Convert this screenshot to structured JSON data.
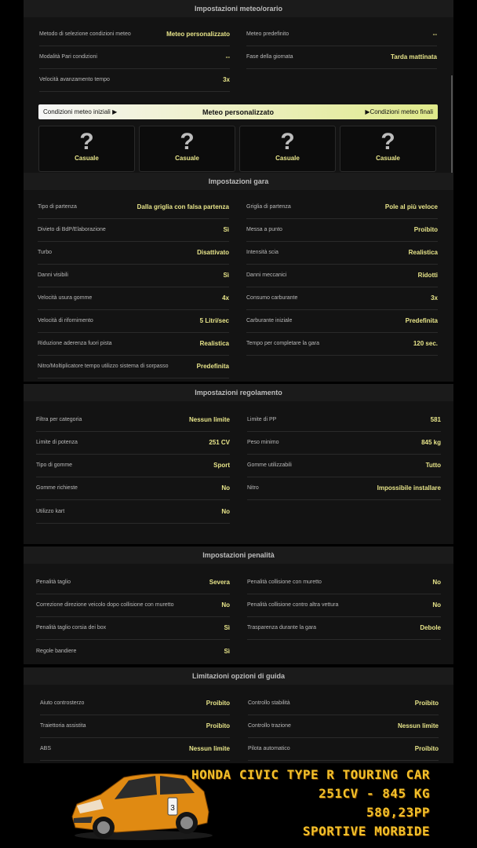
{
  "meteo": {
    "title": "Impostazioni meteo/orario",
    "left": [
      {
        "label": "Metodo di selezione condizioni meteo",
        "value": "Meteo personalizzato"
      },
      {
        "label": "Modalità Pari condizioni",
        "value": "--"
      },
      {
        "label": "Velocità avanzamento tempo",
        "value": "3x"
      }
    ],
    "right": [
      {
        "label": "Meteo predefinito",
        "value": "--"
      },
      {
        "label": "Fase della giornata",
        "value": "Tarda mattinata"
      }
    ],
    "bar": {
      "initial": "Condizioni meteo iniziali",
      "current": "Meteo personalizzato",
      "final": "Condizioni meteo finali"
    },
    "cards": [
      {
        "icon": "question-mark-icon",
        "label": "Casuale"
      },
      {
        "icon": "question-mark-icon",
        "label": "Casuale"
      },
      {
        "icon": "question-mark-icon",
        "label": "Casuale"
      },
      {
        "icon": "question-mark-icon",
        "label": "Casuale"
      }
    ]
  },
  "gara": {
    "title": "Impostazioni gara",
    "left": [
      {
        "label": "Tipo di partenza",
        "value": "Dalla griglia con falsa partenza"
      },
      {
        "label": "Divieto di BdP/Elaborazione",
        "value": "Sì"
      },
      {
        "label": "Turbo",
        "value": "Disattivato"
      },
      {
        "label": "Danni visibili",
        "value": "Sì"
      },
      {
        "label": "Velocità usura gomme",
        "value": "4x"
      },
      {
        "label": "Velocità di rifornimento",
        "value": "5 Litri/sec"
      },
      {
        "label": "Riduzione aderenza fuori pista",
        "value": "Realistica"
      },
      {
        "label": "Nitro/Moltiplicatore tempo utilizzo sistema di sorpasso",
        "value": "Predefinita"
      }
    ],
    "right": [
      {
        "label": "Griglia di partenza",
        "value": "Pole al più veloce"
      },
      {
        "label": "Messa a punto",
        "value": "Proibito"
      },
      {
        "label": "Intensità scia",
        "value": "Realistica"
      },
      {
        "label": "Danni meccanici",
        "value": "Ridotti"
      },
      {
        "label": "Consumo carburante",
        "value": "3x"
      },
      {
        "label": "Carburante iniziale",
        "value": "Predefinita"
      },
      {
        "label": "Tempo per completare la gara",
        "value": "120 sec."
      }
    ]
  },
  "regolamento": {
    "title": "Impostazioni regolamento",
    "left": [
      {
        "label": "Filtra per categoria",
        "value": "Nessun limite"
      },
      {
        "label": "Limite di potenza",
        "value": "251 CV"
      },
      {
        "label": "Tipo di gomme",
        "value": "Sport"
      },
      {
        "label": "Gomme richieste",
        "value": "No"
      },
      {
        "label": "Utilizzo kart",
        "value": "No"
      }
    ],
    "right": [
      {
        "label": "Limite di PP",
        "value": "581"
      },
      {
        "label": "Peso minimo",
        "value": "845 kg"
      },
      {
        "label": "Gomme utilizzabili",
        "value": "Tutto"
      },
      {
        "label": "Nitro",
        "value": "Impossibile installare"
      }
    ]
  },
  "penalita": {
    "title": "Impostazioni penalità",
    "left": [
      {
        "label": "Penalità taglio",
        "value": "Severa"
      },
      {
        "label": "Correzione direzione veicolo dopo collisione con muretto",
        "value": "No"
      },
      {
        "label": "Penalità taglio corsia dei box",
        "value": "Sì"
      },
      {
        "label": "Regole bandiere",
        "value": "Sì"
      }
    ],
    "right": [
      {
        "label": "Penalità collisione con muretto",
        "value": "No"
      },
      {
        "label": "Penalità collisione contro altra vettura",
        "value": "No"
      },
      {
        "label": "Trasparenza durante la gara",
        "value": "Debole"
      }
    ]
  },
  "guida": {
    "title": "Limitazioni opzioni di guida",
    "left": [
      {
        "label": "Aiuto controsterzo",
        "value": "Proibito"
      },
      {
        "label": "Traiettoria assistita",
        "value": "Proibito"
      },
      {
        "label": "ABS",
        "value": "Nessun limite"
      }
    ],
    "right": [
      {
        "label": "Controllo stabilità",
        "value": "Proibito"
      },
      {
        "label": "Controllo trazione",
        "value": "Nessun limite"
      },
      {
        "label": "Pilota automatico",
        "value": "Proibito"
      }
    ]
  },
  "car": {
    "line1": "HONDA CIVIC TYPE R TOURING CAR",
    "line2": "251CV - 845 KG",
    "line3": "580,23PP",
    "line4": "SPORTIVE MORBIDE",
    "body_color": "#e08a12"
  }
}
